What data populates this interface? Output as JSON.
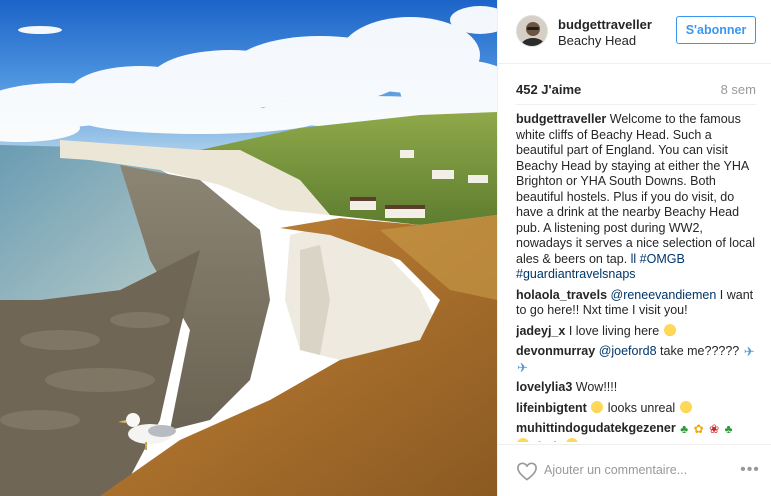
{
  "post": {
    "username": "budgettraveller",
    "location": "Beachy Head",
    "follow_label": "S'abonner",
    "likes": "452 J'aime",
    "time_ago": "8 sem"
  },
  "comments": [
    {
      "user": "budgettraveller",
      "text": " Welcome to the famous white cliffs of Beachy Head. Such a beautiful part of England. You can visit Beachy Head by staying at either the YHA Brighton or YHA South Downs. Both beautiful hostels. Plus if you do visit, do have a drink at the nearby Beachy Head pub. A listening post during WW2, nowadays it serves a nice selection of local ales & beers on tap. ",
      "tags": [
        "ll #OMGB",
        "#guardiantravelsnaps"
      ]
    },
    {
      "user": "holaola_travels",
      "mention": "@reneevandiemen",
      "text": " I want to go here!! Nxt time I visit you!"
    },
    {
      "user": "jadeyj_x",
      "text": " I love living here "
    },
    {
      "user": "devonmurray",
      "mention": "@joeford8",
      "text": " take me?????"
    },
    {
      "user": "lovelylia3",
      "text": " Wow!!!!"
    },
    {
      "user": "lifeinbigtent",
      "text": " looks unreal "
    },
    {
      "user": "muhittindogudatekgezener",
      "text": ""
    }
  ],
  "footer": {
    "comment_placeholder": "Ajouter un commentaire...",
    "more_label": "•••"
  },
  "icons": {
    "like": "heart-icon",
    "more": "more-options-icon",
    "avatar": "avatar"
  },
  "colors": {
    "follow_blue": "#3897f0",
    "link_blue": "#003569",
    "muted": "#999999",
    "text": "#262626"
  }
}
